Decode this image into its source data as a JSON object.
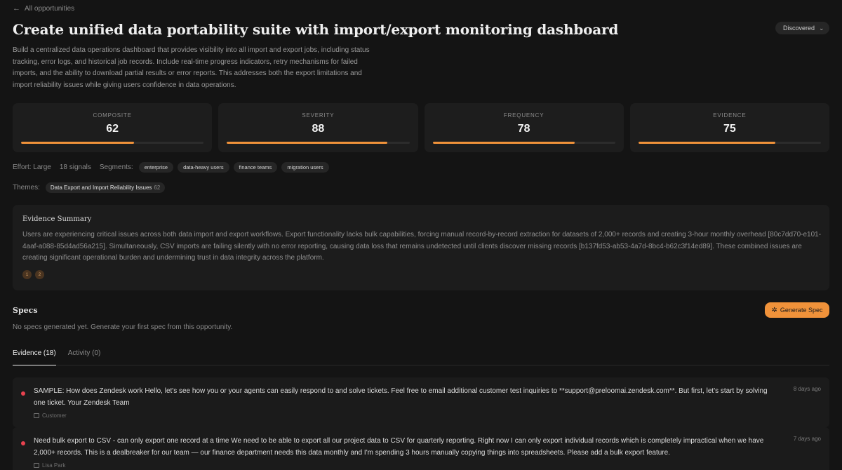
{
  "nav": {
    "back_label": "All opportunities"
  },
  "header": {
    "title": "Create unified data portability suite with import/export monitoring dashboard",
    "status": "Discovered"
  },
  "description": "Build a centralized data operations dashboard that provides visibility into all import and export jobs, including status tracking, error logs, and historical job records. Include real-time progress indicators, retry mechanisms for failed imports, and the ability to download partial results or error reports. This addresses both the export limitations and import reliability issues while giving users confidence in data operations.",
  "metrics": [
    {
      "label": "COMPOSITE",
      "value": "62",
      "progress": 0.62
    },
    {
      "label": "SEVERITY",
      "value": "88",
      "progress": 0.88
    },
    {
      "label": "FREQUENCY",
      "value": "78",
      "progress": 0.78
    },
    {
      "label": "EVIDENCE",
      "value": "75",
      "progress": 0.75
    }
  ],
  "meta": {
    "effort": "Effort: Large",
    "signals": "18 signals",
    "segments_label": "Segments:",
    "segments": [
      "enterprise",
      "data-heavy users",
      "finance teams",
      "migration users"
    ]
  },
  "themes": {
    "label": "Themes:",
    "items": [
      {
        "name": "Data Export and Import Reliability Issues",
        "count": "62"
      }
    ]
  },
  "evidence_summary": {
    "title": "Evidence Summary",
    "text": "Users are experiencing critical issues across both data import and export workflows. Export functionality lacks bulk capabilities, forcing manual record-by-record extraction for datasets of 2,000+ records and creating 3-hour monthly overhead [80c7dd70-e101-4aaf-a088-85d4ad56a215]. Simultaneously, CSV imports are failing silently with no error reporting, causing data loss that remains undetected until clients discover missing records [b137fd53-ab53-4a7d-8bc4-b62c3f14ed89]. These combined issues are creating significant operational burden and undermining trust in data integrity across the platform.",
    "citations": [
      "1",
      "2"
    ]
  },
  "specs": {
    "title": "Specs",
    "empty_text": "No specs generated yet. Generate your first spec from this opportunity.",
    "generate_label": "Generate Spec"
  },
  "tabs": [
    {
      "label": "Evidence (18)",
      "active": true
    },
    {
      "label": "Activity (0)",
      "active": false
    }
  ],
  "evidence": [
    {
      "text": "SAMPLE: How does Zendesk work Hello, let's see how you or your agents can easily respond to and solve tickets. Feel free to email additional customer test inquiries to **support@preloomai.zendesk.com**. But first, let's start by solving one ticket. Your Zendesk Team",
      "time": "8 days ago",
      "author": "Customer"
    },
    {
      "text": "Need bulk export to CSV - can only export one record at a time We need to be able to export all our project data to CSV for quarterly reporting. Right now I can only export individual records which is completely impractical when we have 2,000+ records. This is a dealbreaker for our team — our finance department needs this data monthly and I'm spending 3 hours manually copying things into spreadsheets. Please add a bulk export feature.",
      "time": "7 days ago",
      "author": "Lisa Park"
    }
  ],
  "colors": {
    "accent": "#f0923a",
    "unread_dot": "#e8424f",
    "background": "#141414"
  }
}
